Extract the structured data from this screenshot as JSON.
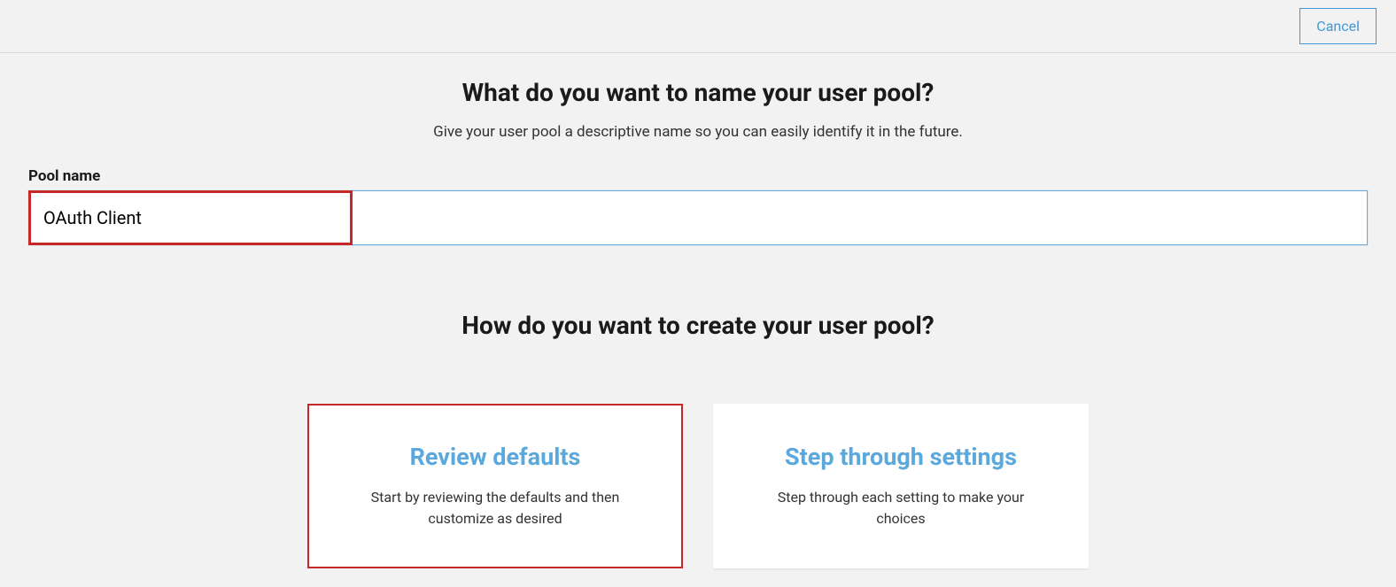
{
  "header": {
    "cancel_label": "Cancel"
  },
  "section1": {
    "heading": "What do you want to name your user pool?",
    "subtext": "Give your user pool a descriptive name so you can easily identify it in the future.",
    "field_label": "Pool name",
    "pool_name_value": "OAuth Client"
  },
  "section2": {
    "heading": "How do you want to create your user pool?",
    "options": [
      {
        "title": "Review defaults",
        "desc": "Start by reviewing the defaults and then customize as desired"
      },
      {
        "title": "Step through settings",
        "desc": "Step through each setting to make your choices"
      }
    ]
  }
}
